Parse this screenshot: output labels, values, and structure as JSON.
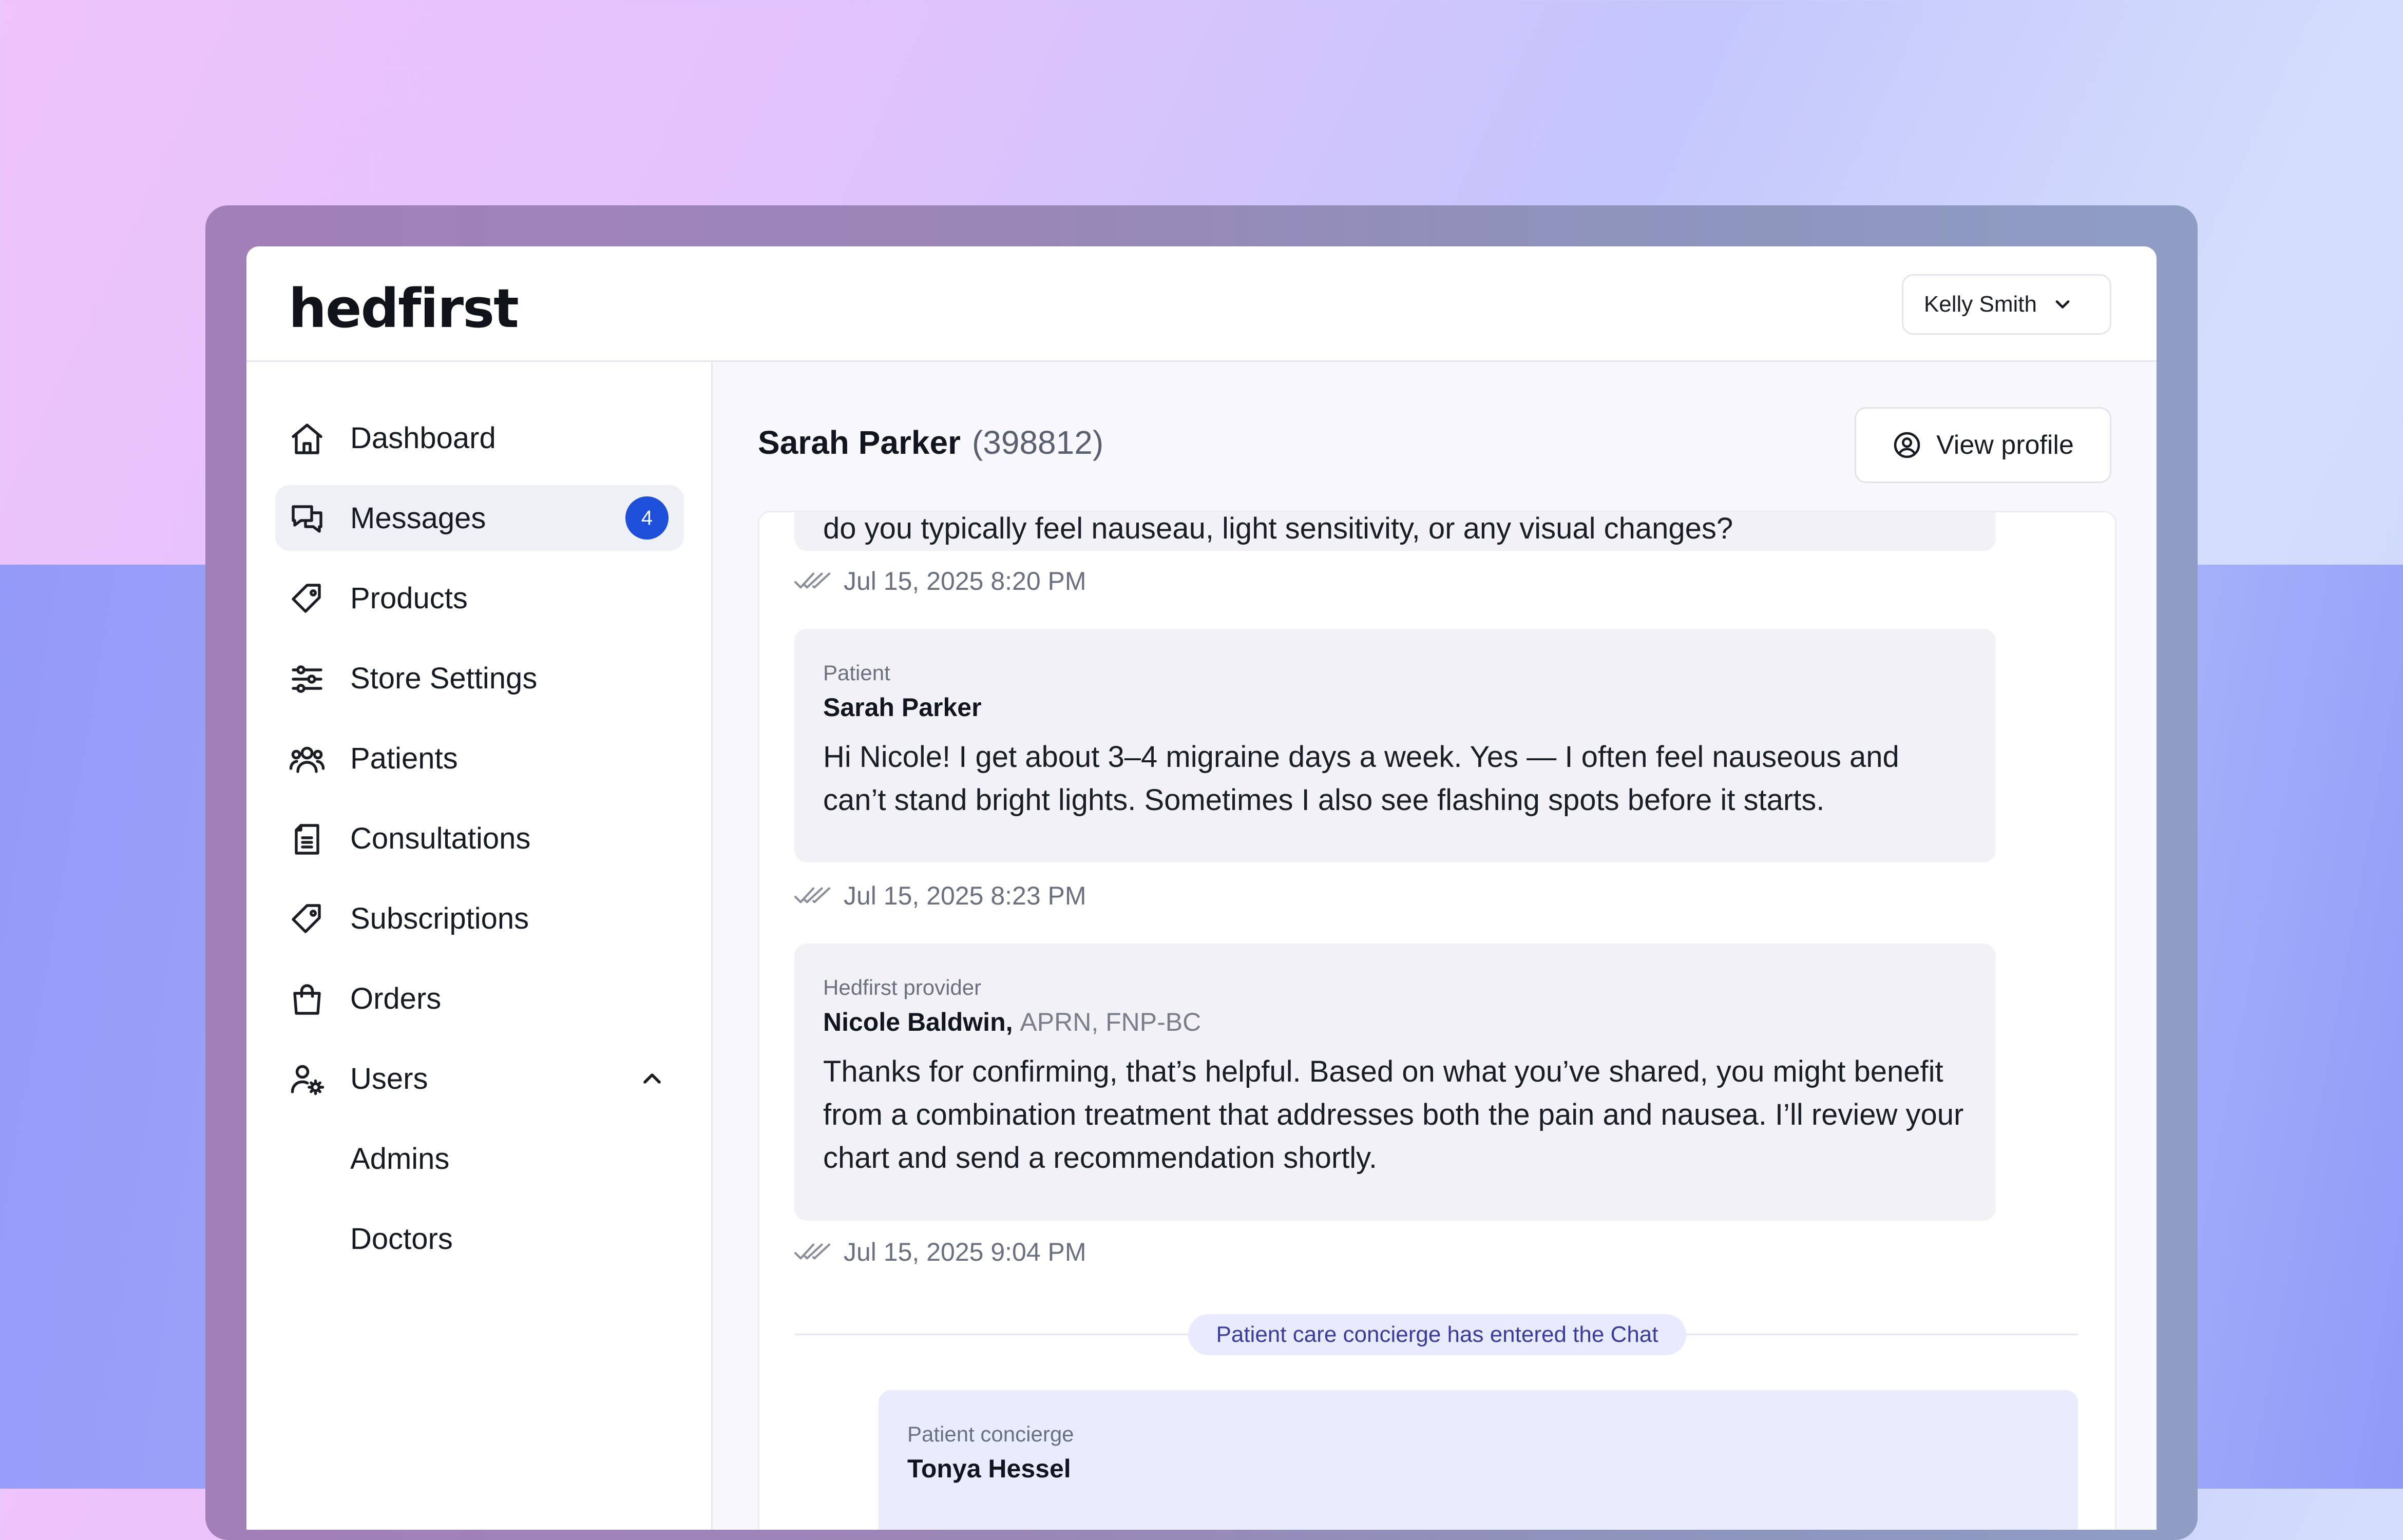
{
  "app": {
    "logo": "hedfirst"
  },
  "header": {
    "user_name": "Kelly Smith"
  },
  "sidebar": {
    "items": [
      {
        "label": "Dashboard",
        "icon": "home-icon"
      },
      {
        "label": "Messages",
        "icon": "messages-icon",
        "badge": "4",
        "active": true
      },
      {
        "label": "Products",
        "icon": "tag-icon"
      },
      {
        "label": "Store Settings",
        "icon": "sliders-icon"
      },
      {
        "label": "Patients",
        "icon": "users-icon"
      },
      {
        "label": "Consultations",
        "icon": "document-icon"
      },
      {
        "label": "Subscriptions",
        "icon": "tag-icon"
      },
      {
        "label": "Orders",
        "icon": "shopping-bag-icon"
      },
      {
        "label": "Users",
        "icon": "user-gear-icon",
        "expanded": true
      }
    ],
    "subitems": [
      {
        "label": "Admins"
      },
      {
        "label": "Doctors"
      }
    ]
  },
  "conversation": {
    "patient_name": "Sarah Parker",
    "patient_id": "(398812)",
    "view_profile_label": "View profile",
    "messages": [
      {
        "body_partial": "do you typically feel nauseau, light sensitivity, or any visual changes?",
        "timestamp": "Jul 15, 2025 8:20 PM"
      },
      {
        "role": "Patient",
        "author": "Sarah Parker",
        "body": "Hi Nicole! I get about 3–4 migraine days a week. Yes — I often feel nauseous and can’t stand bright lights. Sometimes I also see flashing spots before it starts.",
        "timestamp": "Jul 15, 2025 8:23 PM"
      },
      {
        "role": "Hedfirst provider",
        "author": "Nicole Baldwin,",
        "credentials": "APRN, FNP-BC",
        "body": "Thanks for confirming, that’s helpful. Based on what you’ve shared, you might benefit from a combination treatment that addresses both the pain and nausea. I’ll review your chart and send a recommendation shortly.",
        "timestamp": "Jul 15, 2025 9:04 PM"
      }
    ],
    "system_event": "Patient care concierge has entered the Chat",
    "concierge_message": {
      "role": "Patient concierge",
      "author": "Tonya Hessel"
    }
  },
  "colors": {
    "accent": "#1d4fd8",
    "system_pill_text": "#3a3b9c"
  }
}
